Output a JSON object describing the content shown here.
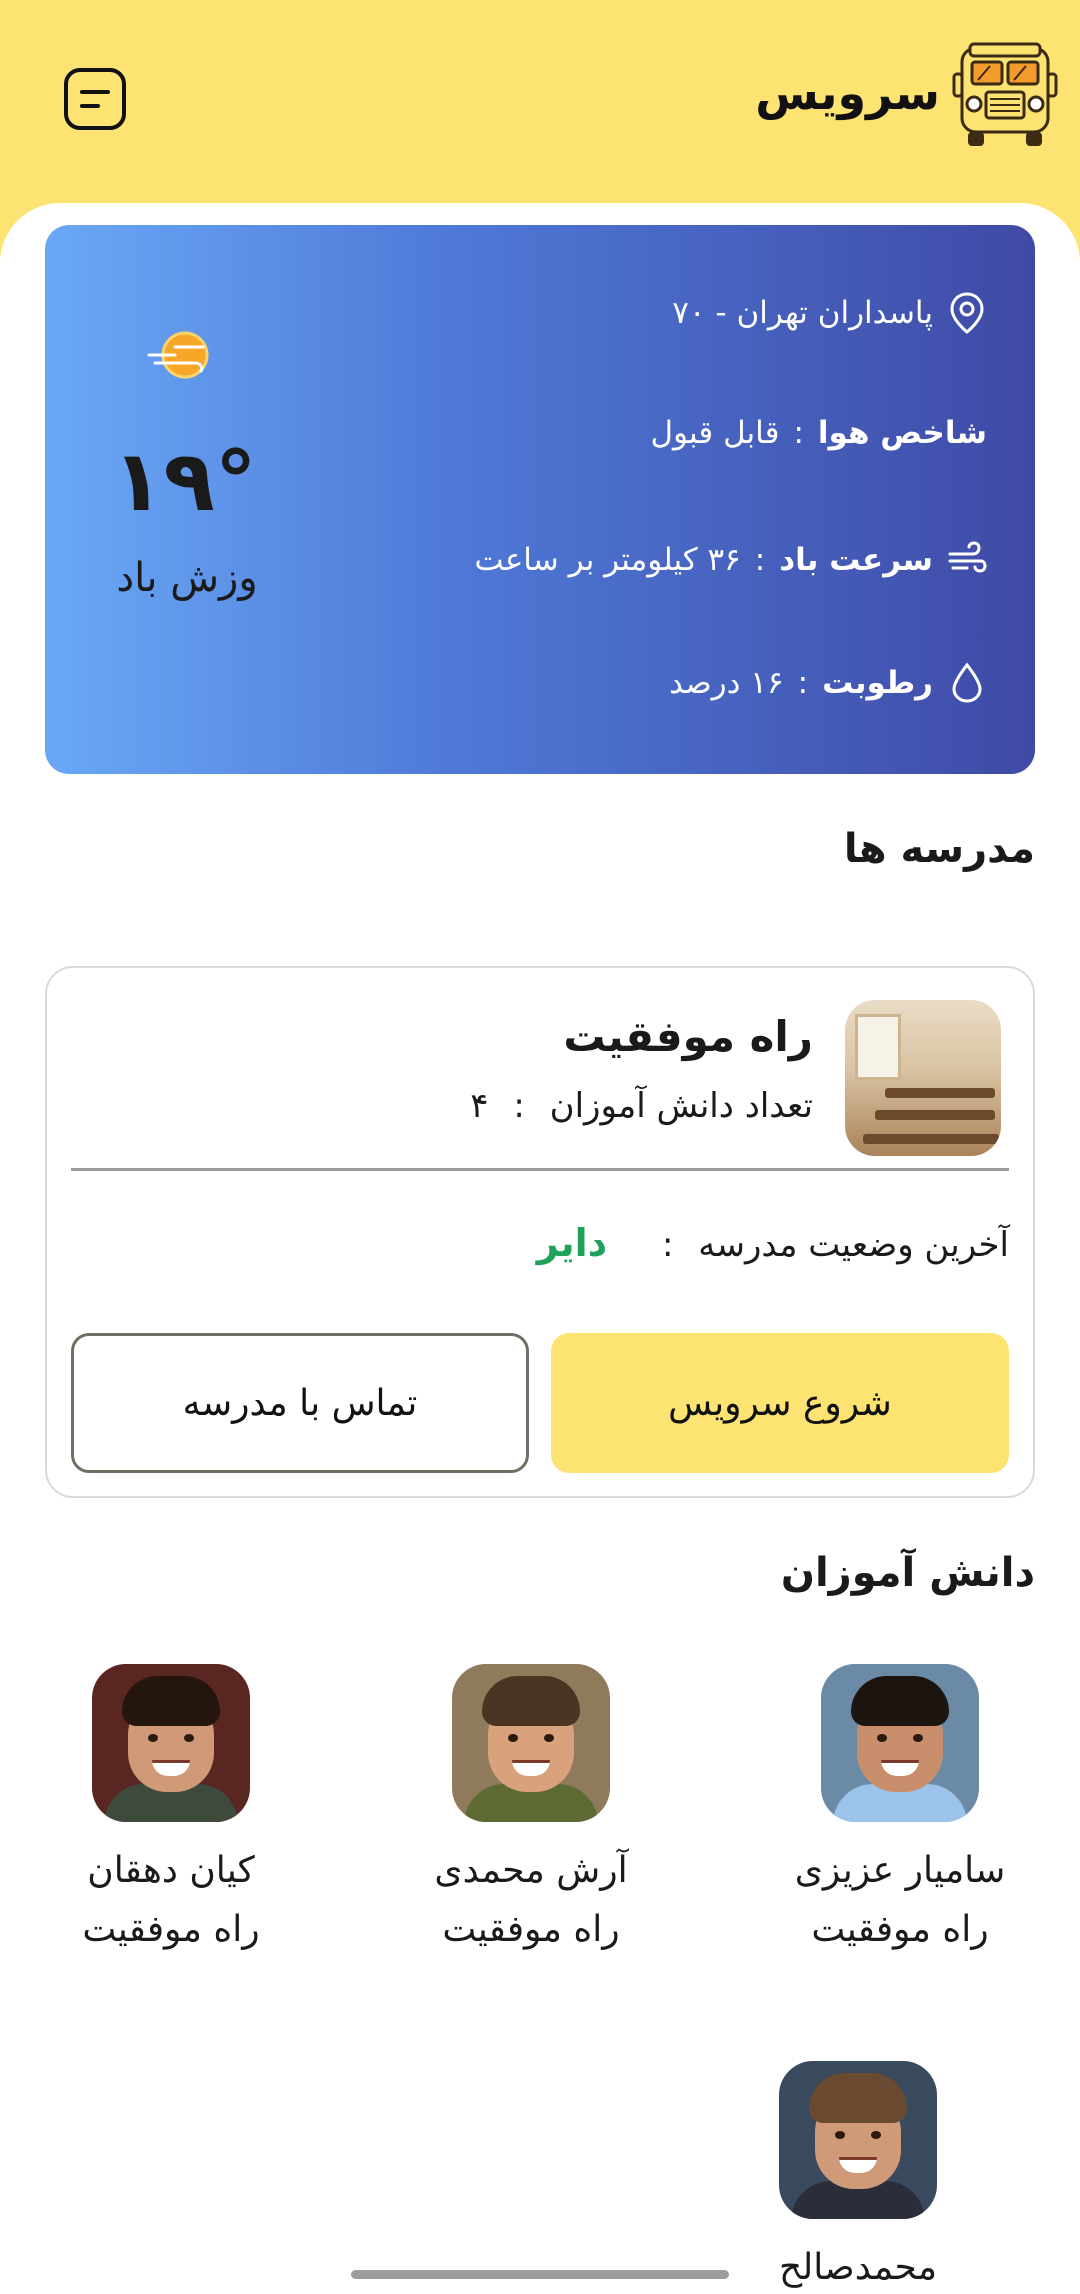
{
  "header": {
    "title": "سرویس",
    "logo_icon": "school-bus-icon",
    "menu_icon": "menu-icon",
    "background": "#FDE372"
  },
  "weather": {
    "location": "پاسداران تهران - ۷۰",
    "air_quality_label": "شاخص هوا",
    "air_quality_value": "قابل قبول",
    "wind_label": "سرعت باد",
    "wind_value": "۳۶ کیلومتر بر ساعت",
    "humidity_label": "رطوبت",
    "humidity_value": "۱۶ درصد",
    "temperature": "۱۹°",
    "condition": "وزش باد",
    "colon": ":"
  },
  "schools_section": {
    "title": "مدرسه ها",
    "school": {
      "name": "راه موفقیت",
      "student_count_label": "تعداد دانش آموزان",
      "student_count_value": "۴",
      "status_label": "آخرین وضعیت مدرسه",
      "status_value": "دایر",
      "status_color": "#1fa35a",
      "start_button": "شروع سرویس",
      "contact_button": "تماس با مدرسه"
    }
  },
  "students_section": {
    "title": "دانش آموزان",
    "students": [
      {
        "name": "سامیار عزیزی",
        "school": "راه موفقیت"
      },
      {
        "name": "آرش محمدی",
        "school": "راه موفقیت"
      },
      {
        "name": "کیان دهقان",
        "school": "راه موفقیت"
      },
      {
        "name": "محمدصالح صمدی",
        "school": ""
      }
    ]
  }
}
